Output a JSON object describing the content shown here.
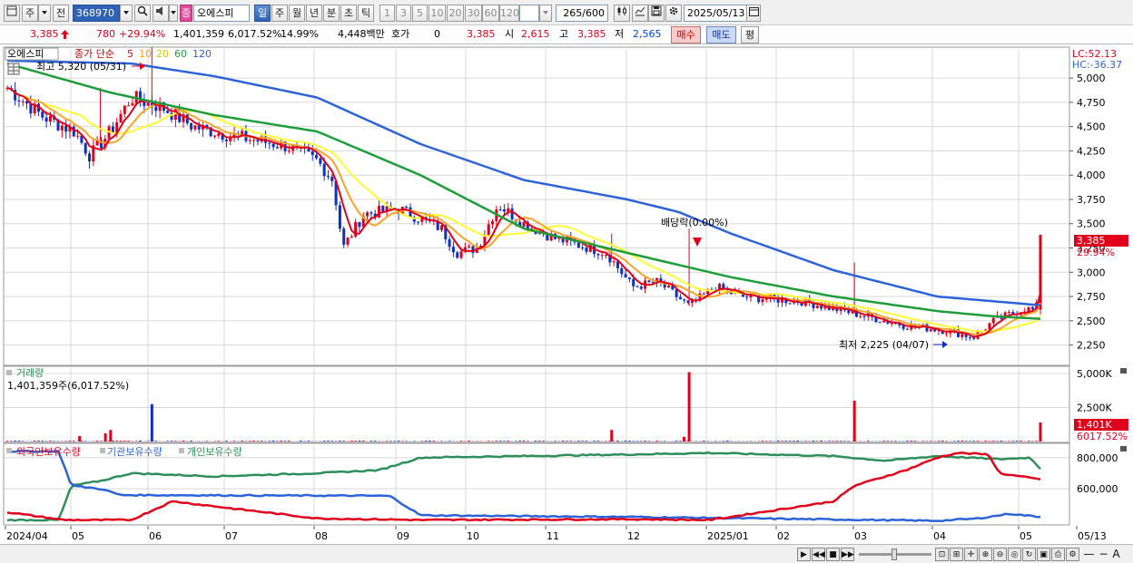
{
  "toolbar": {
    "period_label": "주",
    "prev_label": "전",
    "stock_code": "368970",
    "stock_badge": "증",
    "stock_name": "오에스피",
    "timeframes": [
      "일",
      "주",
      "월",
      "년",
      "분",
      "초",
      "틱"
    ],
    "minute_options": [
      "1",
      "3",
      "5",
      "10",
      "20",
      "30",
      "60",
      "120"
    ],
    "count_value": "265",
    "count_total": "/600",
    "date_value": "2025/05/13"
  },
  "quote": {
    "price": "3,385",
    "change": "780",
    "change_pct": "+29.94%",
    "volume": "1,401,359",
    "volume_pct": "6,017.52%",
    "turnover_pct": "14.99%",
    "amount": "4,448백만",
    "hoga_label": "호가",
    "hoga_value": "0",
    "hoga_price": "3,385",
    "open_label": "시",
    "open_value": "2,615",
    "high_label": "고",
    "high_value": "3,385",
    "low_label": "저",
    "low_value": "2,565",
    "buy_label": "매수",
    "sell_label": "매도",
    "eval_label": "평"
  },
  "colors": {
    "up": "#e0001b",
    "down": "#1030c0",
    "ma5": "#e0001b",
    "ma10": "#f7a428",
    "ma20": "#fdfd30",
    "ma60": "#1e9e3a",
    "ma120": "#2d63d8",
    "foreign": "#e0001b",
    "institution": "#2d63d8",
    "individual": "#2e8f5a",
    "grid": "#d7d7d7",
    "axis_bg": "#ffffff"
  },
  "chart_data": [
    {
      "type": "candlestick",
      "title": "오에스피",
      "legend": {
        "prefix": "종가 단순",
        "periods": [
          "5",
          "10",
          "20",
          "60",
          "120"
        ]
      },
      "lc_label": "LC:52.13",
      "hc_label": "HC:-36.37",
      "y_ticks": [
        5000,
        4750,
        4500,
        4250,
        4000,
        3750,
        3500,
        3250,
        3000,
        2750,
        2500,
        2250
      ],
      "y_tick_labels": [
        "5,000",
        "4,750",
        "4,500",
        "4,250",
        "4,000",
        "3,750",
        "3,500",
        "3,250",
        "3,000",
        "2,750",
        "2,500",
        "2,250"
      ],
      "ylim": [
        2050,
        5300
      ],
      "x_labels": [
        "2024/04",
        "05",
        "06",
        "07",
        "08",
        "09",
        "10",
        "11",
        "12",
        "2025/01",
        "02",
        "03",
        "04",
        "05",
        "05/13"
      ],
      "close_anchors": [
        {
          "t": 0.0,
          "v": 4900
        },
        {
          "t": 0.035,
          "v": 4600
        },
        {
          "t": 0.065,
          "v": 4450
        },
        {
          "t": 0.08,
          "v": 4200
        },
        {
          "t": 0.1,
          "v": 4450
        },
        {
          "t": 0.12,
          "v": 4800
        },
        {
          "t": 0.15,
          "v": 4700
        },
        {
          "t": 0.18,
          "v": 4500
        },
        {
          "t": 0.22,
          "v": 4400
        },
        {
          "t": 0.27,
          "v": 4300
        },
        {
          "t": 0.3,
          "v": 4150
        },
        {
          "t": 0.315,
          "v": 3950
        },
        {
          "t": 0.325,
          "v": 3250
        },
        {
          "t": 0.345,
          "v": 3600
        },
        {
          "t": 0.38,
          "v": 3650
        },
        {
          "t": 0.42,
          "v": 3450
        },
        {
          "t": 0.435,
          "v": 3200
        },
        {
          "t": 0.455,
          "v": 3250
        },
        {
          "t": 0.475,
          "v": 3700
        },
        {
          "t": 0.5,
          "v": 3500
        },
        {
          "t": 0.53,
          "v": 3350
        },
        {
          "t": 0.58,
          "v": 3200
        },
        {
          "t": 0.605,
          "v": 2850
        },
        {
          "t": 0.63,
          "v": 2900
        },
        {
          "t": 0.66,
          "v": 2650
        },
        {
          "t": 0.685,
          "v": 2850
        },
        {
          "t": 0.71,
          "v": 2750
        },
        {
          "t": 0.77,
          "v": 2700
        },
        {
          "t": 0.81,
          "v": 2600
        },
        {
          "t": 0.87,
          "v": 2450
        },
        {
          "t": 0.91,
          "v": 2400
        },
        {
          "t": 0.935,
          "v": 2330
        },
        {
          "t": 0.955,
          "v": 2500
        },
        {
          "t": 0.985,
          "v": 2630
        },
        {
          "t": 0.996,
          "v": 2605
        },
        {
          "t": 1.0,
          "v": 3385
        }
      ],
      "ma60_anchors": [
        {
          "t": 0.0,
          "v": 5150
        },
        {
          "t": 0.1,
          "v": 4850
        },
        {
          "t": 0.2,
          "v": 4620
        },
        {
          "t": 0.3,
          "v": 4450
        },
        {
          "t": 0.4,
          "v": 4000
        },
        {
          "t": 0.5,
          "v": 3450
        },
        {
          "t": 0.6,
          "v": 3200
        },
        {
          "t": 0.7,
          "v": 2950
        },
        {
          "t": 0.8,
          "v": 2750
        },
        {
          "t": 0.9,
          "v": 2600
        },
        {
          "t": 0.95,
          "v": 2550
        },
        {
          "t": 1.0,
          "v": 2520
        }
      ],
      "ma120_anchors": [
        {
          "t": 0.0,
          "v": 5180
        },
        {
          "t": 0.12,
          "v": 5150
        },
        {
          "t": 0.2,
          "v": 5020
        },
        {
          "t": 0.3,
          "v": 4800
        },
        {
          "t": 0.4,
          "v": 4320
        },
        {
          "t": 0.5,
          "v": 3950
        },
        {
          "t": 0.6,
          "v": 3750
        },
        {
          "t": 0.65,
          "v": 3620
        },
        {
          "t": 0.7,
          "v": 3400
        },
        {
          "t": 0.8,
          "v": 3020
        },
        {
          "t": 0.9,
          "v": 2750
        },
        {
          "t": 1.0,
          "v": 2660
        }
      ],
      "annotations": {
        "high": "최고 5,320 (05/31)",
        "low": "최저 2,225 (04/07)",
        "dividend": "배당락(0.00%)",
        "current_price": "3,385",
        "current_pct": "29.94%"
      }
    },
    {
      "type": "bar",
      "title": "거래량",
      "subtitle": "1,401,359주(6,017.52%)",
      "y_ticks": [
        5000,
        2500
      ],
      "y_tick_labels": [
        "5,000K",
        "2,500K"
      ],
      "ylim": [
        0,
        5400
      ],
      "current_label": "1,401K",
      "current_pct_label": "6017.52%",
      "base_volume": 35,
      "spikes": [
        {
          "t": 0.07,
          "v": 400
        },
        {
          "t": 0.095,
          "v": 600
        },
        {
          "t": 0.1,
          "v": 850
        },
        {
          "t": 0.14,
          "v": 2750
        },
        {
          "t": 0.585,
          "v": 850
        },
        {
          "t": 0.655,
          "v": 350
        },
        {
          "t": 0.66,
          "v": 5100
        },
        {
          "t": 0.82,
          "v": 3000
        },
        {
          "t": 1.0,
          "v": 1401
        }
      ]
    },
    {
      "type": "line",
      "title": "holdings",
      "series_names": [
        "외국인보유수량",
        "기관보유수량",
        "개인보유수량"
      ],
      "y_ticks": [
        800000,
        600000
      ],
      "y_tick_labels": [
        "800,000",
        "600,000"
      ],
      "ylim": [
        380000,
        880000
      ],
      "foreign_anchors": [
        {
          "t": 0.0,
          "v": 450000
        },
        {
          "t": 0.055,
          "v": 400000
        },
        {
          "t": 0.12,
          "v": 400000
        },
        {
          "t": 0.16,
          "v": 520000
        },
        {
          "t": 0.21,
          "v": 480000
        },
        {
          "t": 0.3,
          "v": 410000
        },
        {
          "t": 0.4,
          "v": 400000
        },
        {
          "t": 0.6,
          "v": 405000
        },
        {
          "t": 0.68,
          "v": 400000
        },
        {
          "t": 0.75,
          "v": 470000
        },
        {
          "t": 0.8,
          "v": 520000
        },
        {
          "t": 0.82,
          "v": 620000
        },
        {
          "t": 0.87,
          "v": 720000
        },
        {
          "t": 0.9,
          "v": 800000
        },
        {
          "t": 0.92,
          "v": 830000
        },
        {
          "t": 0.95,
          "v": 820000
        },
        {
          "t": 0.96,
          "v": 700000
        },
        {
          "t": 1.0,
          "v": 660000
        }
      ],
      "institution_anchors": [
        {
          "t": 0.0,
          "v": 840000
        },
        {
          "t": 0.05,
          "v": 840000
        },
        {
          "t": 0.062,
          "v": 620000
        },
        {
          "t": 0.09,
          "v": 600000
        },
        {
          "t": 0.11,
          "v": 560000
        },
        {
          "t": 0.37,
          "v": 555000
        },
        {
          "t": 0.4,
          "v": 430000
        },
        {
          "t": 0.6,
          "v": 420000
        },
        {
          "t": 0.9,
          "v": 395000
        },
        {
          "t": 0.94,
          "v": 410000
        },
        {
          "t": 0.97,
          "v": 440000
        },
        {
          "t": 1.0,
          "v": 420000
        }
      ],
      "individual_anchors": [
        {
          "t": 0.0,
          "v": 400000
        },
        {
          "t": 0.05,
          "v": 400000
        },
        {
          "t": 0.062,
          "v": 620000
        },
        {
          "t": 0.09,
          "v": 650000
        },
        {
          "t": 0.12,
          "v": 700000
        },
        {
          "t": 0.2,
          "v": 680000
        },
        {
          "t": 0.3,
          "v": 700000
        },
        {
          "t": 0.36,
          "v": 720000
        },
        {
          "t": 0.4,
          "v": 800000
        },
        {
          "t": 0.6,
          "v": 820000
        },
        {
          "t": 0.68,
          "v": 830000
        },
        {
          "t": 0.8,
          "v": 810000
        },
        {
          "t": 0.85,
          "v": 780000
        },
        {
          "t": 0.9,
          "v": 810000
        },
        {
          "t": 0.96,
          "v": 790000
        },
        {
          "t": 0.99,
          "v": 800000
        },
        {
          "t": 1.0,
          "v": 730000
        }
      ]
    }
  ]
}
